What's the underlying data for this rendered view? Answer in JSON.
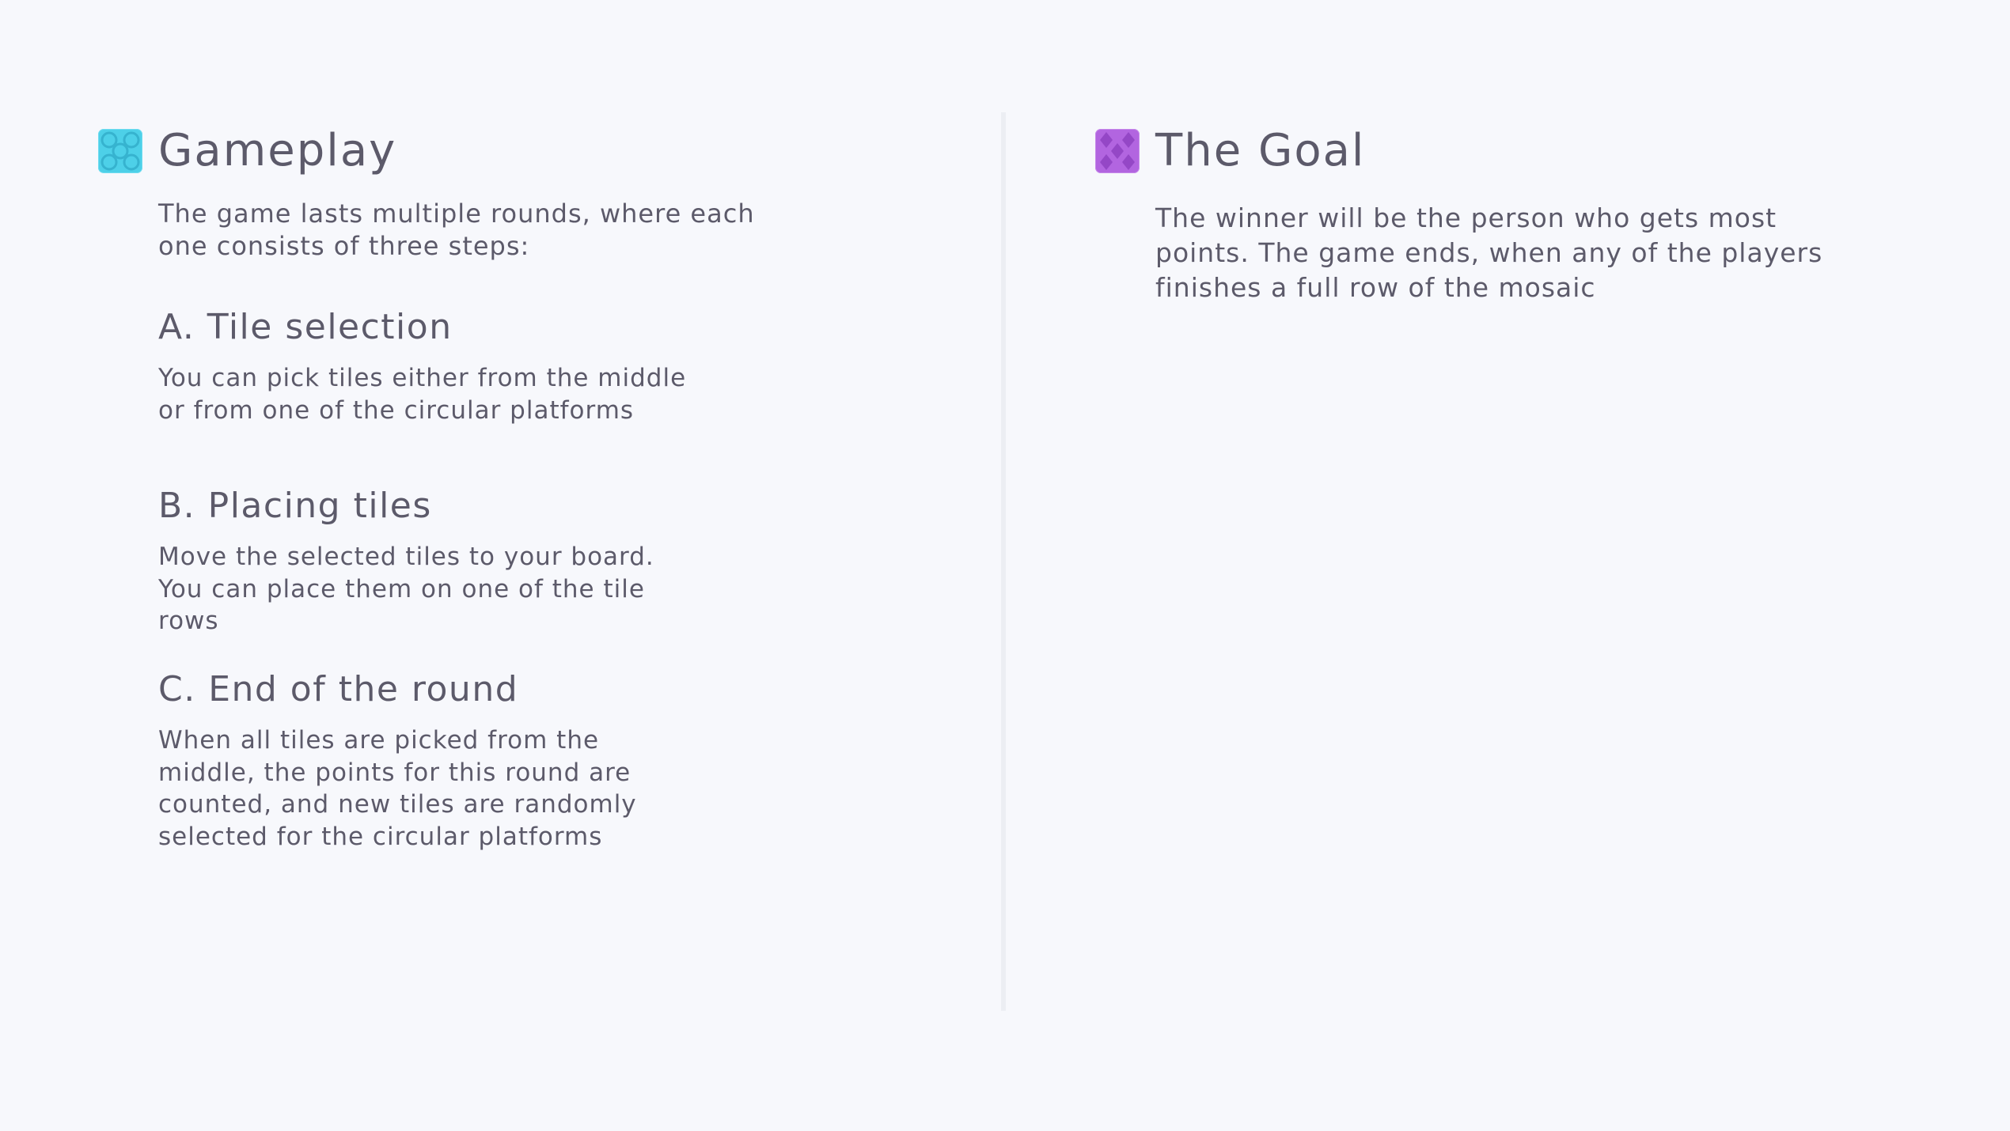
{
  "gameplay": {
    "icon": "cyan-mosaic-tile-icon",
    "icon_color": "#4dd0e8",
    "title": "Gameplay",
    "intro": "The game lasts multiple rounds, where each one consists of three steps:",
    "steps": [
      {
        "title": "A. Tile selection",
        "body": "You can pick tiles either from the middle or from one of the circular platforms"
      },
      {
        "title": "B. Placing tiles",
        "body": "Move the selected tiles to your board. You can place them on one of the tile rows"
      },
      {
        "title": "C. End of the round",
        "body": "When all tiles are picked from the middle, the points for this round are counted, and new tiles are randomly selected for the circular platforms"
      }
    ]
  },
  "goal": {
    "icon": "purple-mosaic-tile-icon",
    "icon_color": "#b265e0",
    "title": "The Goal",
    "body": "The winner will be the person who gets most points. The game ends, when any of the players finishes a full row of the mosaic"
  }
}
